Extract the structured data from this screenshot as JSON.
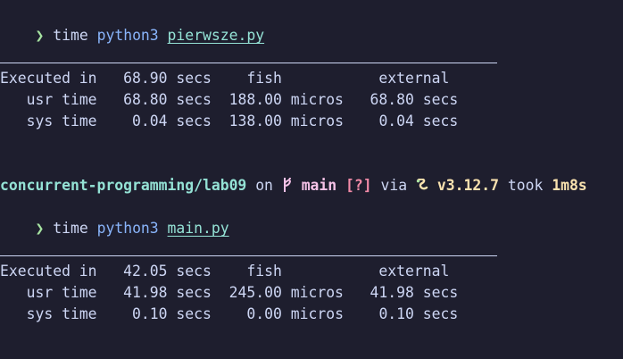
{
  "terminal": {
    "block1": {
      "prompt_symbol": "❯",
      "cmd_time": "time",
      "cmd_prog": "python3",
      "cmd_file": "pierwsze.py",
      "rows": [
        {
          "label": "Executed in",
          "v1": "68.90",
          "u1": "secs",
          "v2": "fish",
          "u2": "",
          "v3": "external",
          "u3": ""
        },
        {
          "label": "usr time",
          "v1": "68.80",
          "u1": "secs",
          "v2": "188.00",
          "u2": "micros",
          "v3": "68.80",
          "u3": "secs"
        },
        {
          "label": "sys time",
          "v1": "0.04",
          "u1": "secs",
          "v2": "138.00",
          "u2": "micros",
          "v3": "0.04",
          "u3": "secs"
        }
      ]
    },
    "prompt2": {
      "dir": "concurrent-programming/lab09",
      "on": "on",
      "branch_icon": "",
      "branch": "main",
      "status": "[?]",
      "via": "via",
      "snake_icon": "snake-icon",
      "version": "v3.12.7",
      "took": "took",
      "duration": "1m8s"
    },
    "block2": {
      "prompt_symbol": "❯",
      "cmd_time": "time",
      "cmd_prog": "python3",
      "cmd_file": "main.py",
      "rows": [
        {
          "label": "Executed in",
          "v1": "42.05",
          "u1": "secs",
          "v2": "fish",
          "u2": "",
          "v3": "external",
          "u3": ""
        },
        {
          "label": "usr time",
          "v1": "41.98",
          "u1": "secs",
          "v2": "245.00",
          "u2": "micros",
          "v3": "41.98",
          "u3": "secs"
        },
        {
          "label": "sys time",
          "v1": "0.10",
          "u1": "secs",
          "v2": "0.00",
          "u2": "micros",
          "v3": "0.10",
          "u3": "secs"
        }
      ]
    }
  },
  "colors": {
    "background": "#1e1e2e",
    "foreground": "#cdd6f4",
    "accent_green": "#a6e3a1",
    "accent_blue": "#89b4fa",
    "accent_teal": "#94e2d5",
    "accent_pink": "#f5c2e7",
    "accent_red": "#f38ba8",
    "accent_yellow": "#f9e2af"
  }
}
